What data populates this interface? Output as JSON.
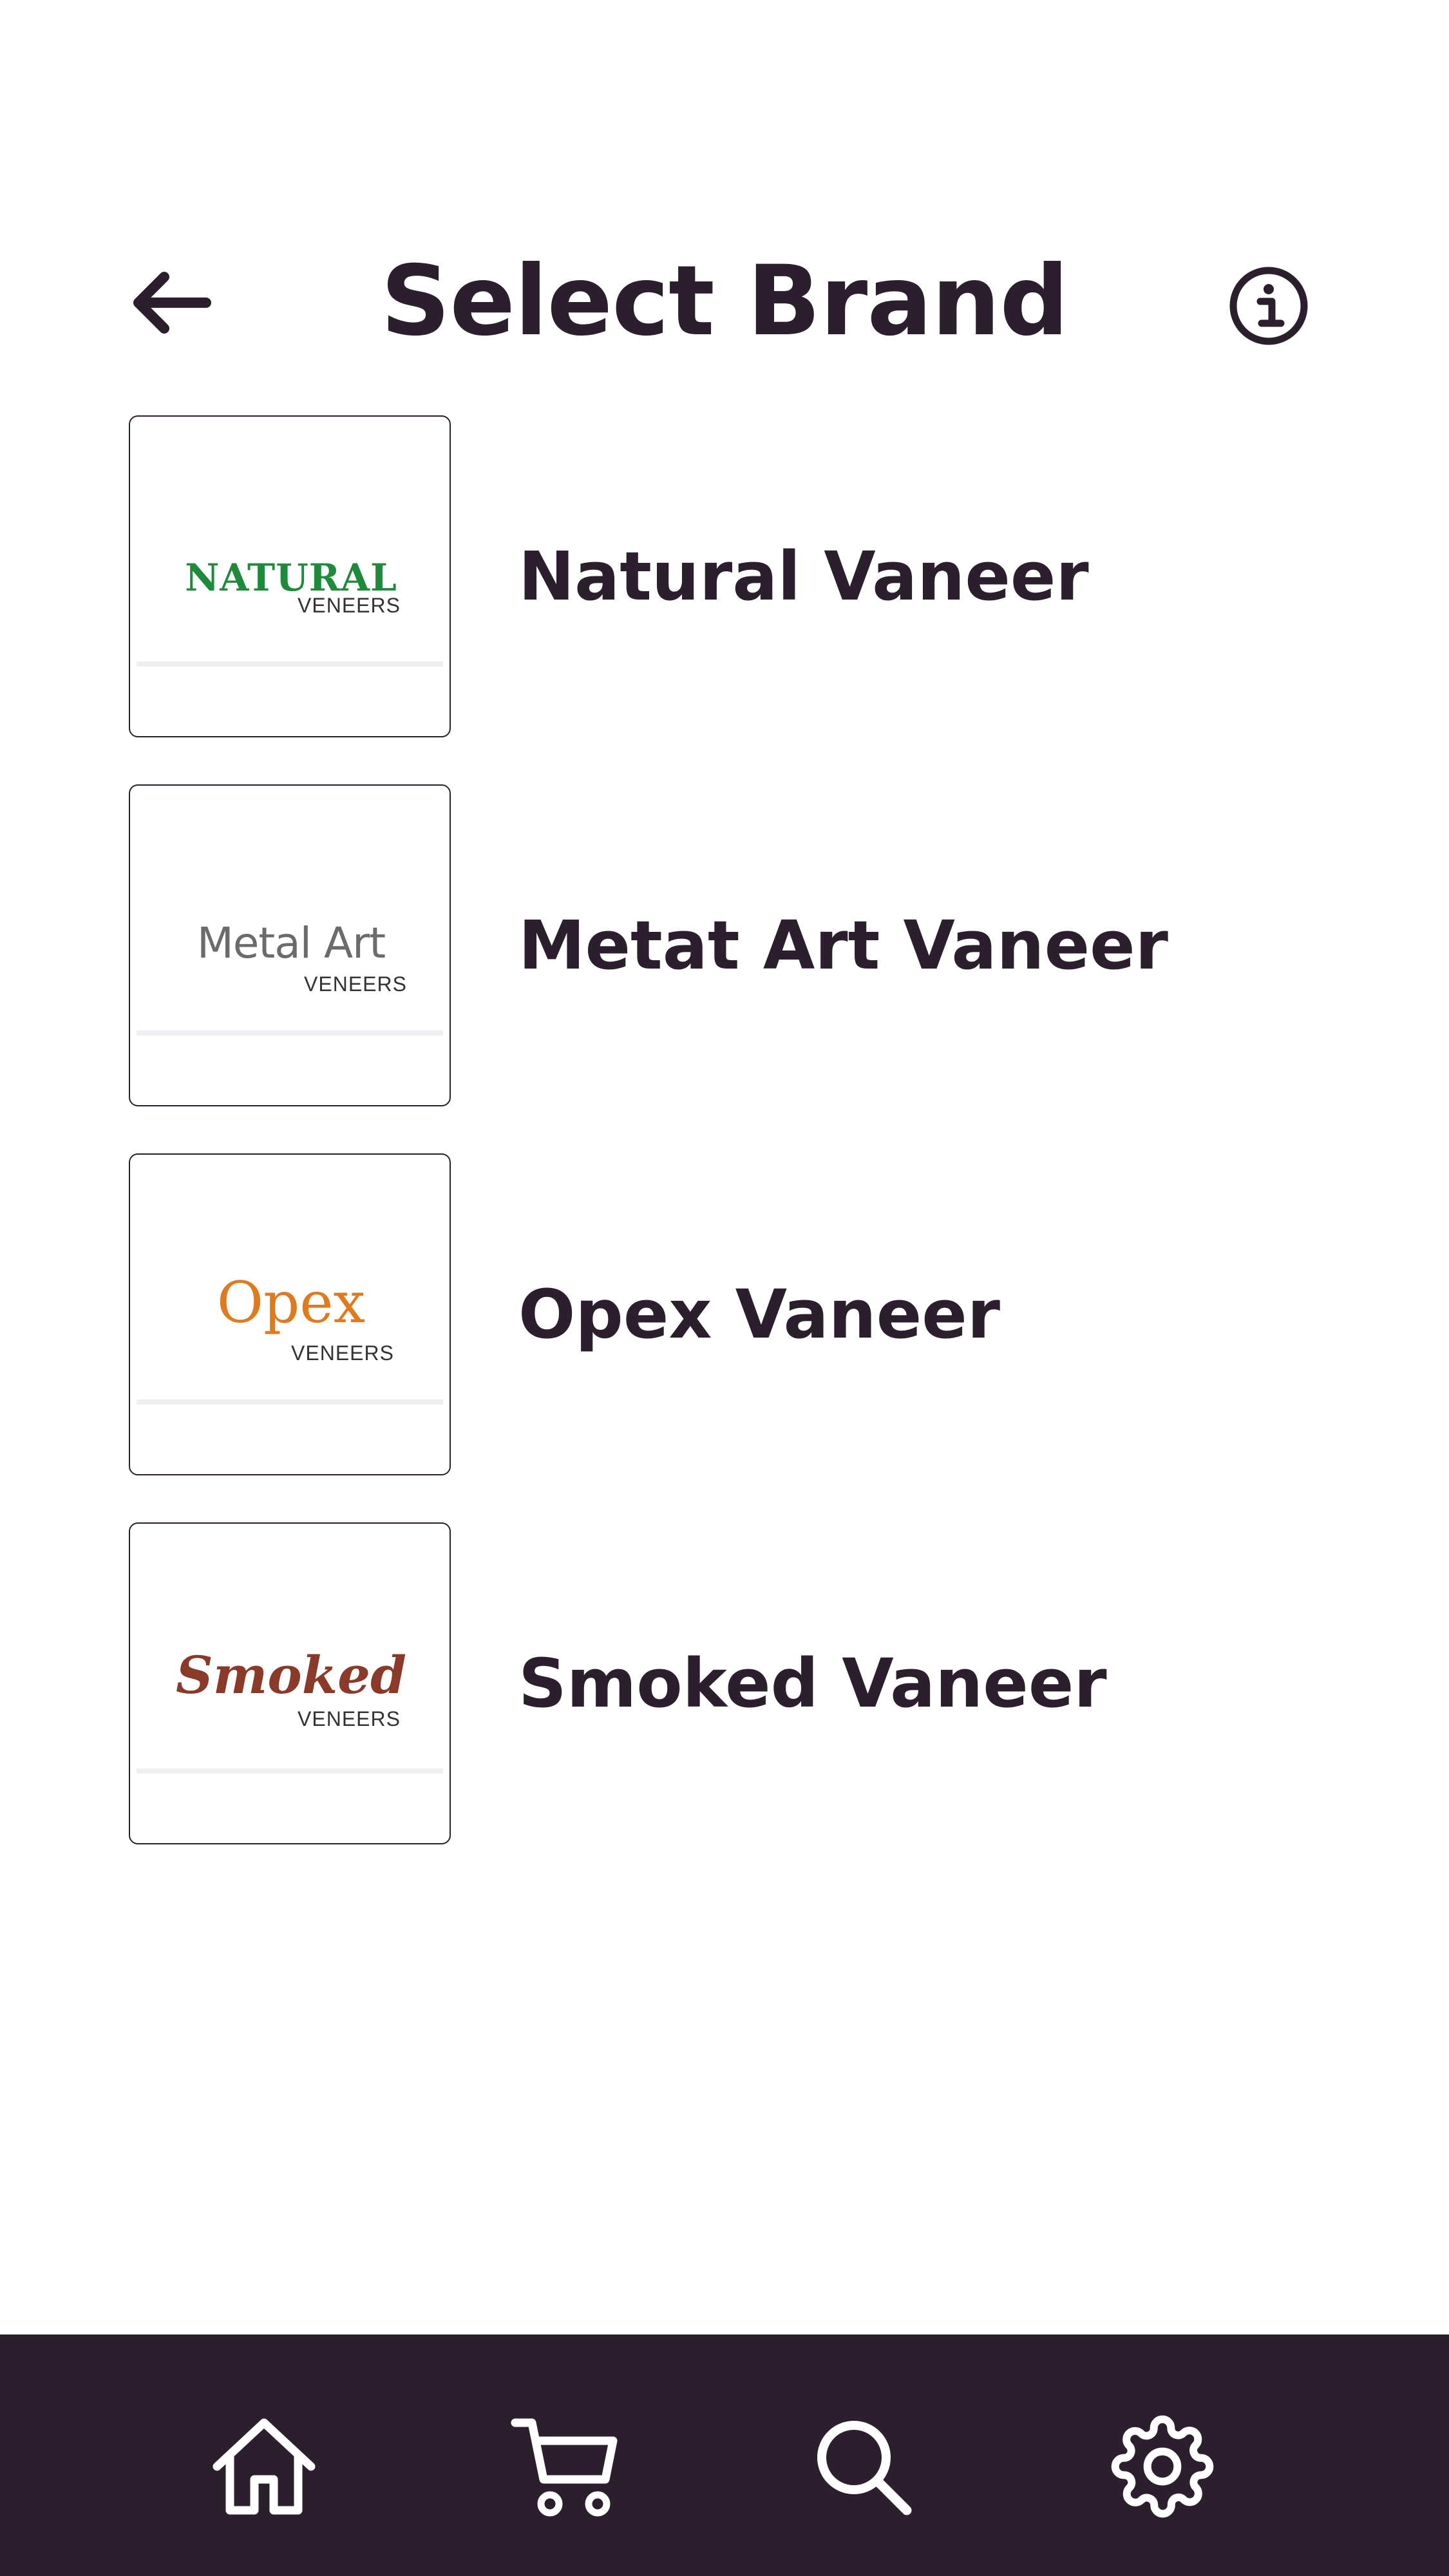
{
  "header": {
    "title": "Select Brand",
    "back_icon": "arrow-left-icon",
    "info_icon": "info-circle-icon"
  },
  "brands": [
    {
      "name": "Natural Vaneer",
      "logo_text": "NATURAL",
      "logo_sub": "VENEERS",
      "logo_color": "#1e8a3c"
    },
    {
      "name": "Metat Art Vaneer",
      "logo_text": "Metal Art",
      "logo_sub": "VENEERS",
      "logo_color": "#6b6b6b"
    },
    {
      "name": "Opex Vaneer",
      "logo_text": "Opex",
      "logo_sub": "VENEERS",
      "logo_color": "#e07a1f"
    },
    {
      "name": "Smoked Vaneer",
      "logo_text": "Smoked",
      "logo_sub": "VENEERS",
      "logo_color": "#8b3a2a"
    }
  ],
  "bottom_nav": {
    "items": [
      {
        "icon": "home-icon"
      },
      {
        "icon": "cart-icon"
      },
      {
        "icon": "search-icon"
      },
      {
        "icon": "settings-icon"
      }
    ]
  },
  "colors": {
    "primary_dark": "#2b1f2e",
    "background": "#ffffff"
  }
}
